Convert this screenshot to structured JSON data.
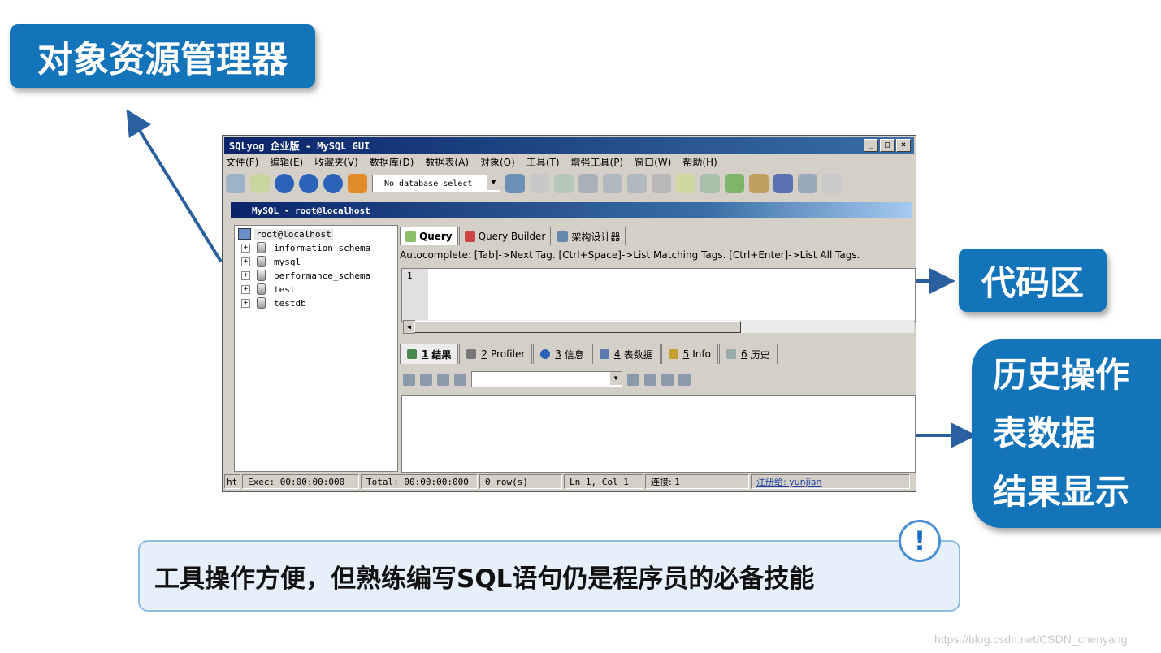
{
  "callouts": {
    "explorer": "对象资源管理器",
    "code": "代码区",
    "history_lines": [
      "历史操作",
      "表数据",
      "结果显示"
    ]
  },
  "tip": {
    "text": "工具操作方便，但熟练编写SQL语句仍是程序员的必备技能",
    "icon": "!"
  },
  "watermark": "https://blog.csdn.net/CSDN_chenyang",
  "window": {
    "title": "SQLyog 企业版 - MySQL GUI",
    "controls": [
      "_",
      "□",
      "×"
    ],
    "menu": [
      "文件(F)",
      "编辑(E)",
      "收藏夹(V)",
      "数据库(D)",
      "数据表(A)",
      "对象(O)",
      "工具(T)",
      "增强工具(P)",
      "窗口(W)",
      "帮助(H)"
    ],
    "db_select": "No database select",
    "connection": "MySQL - root@localhost"
  },
  "explorer": {
    "host": "root@localhost",
    "databases": [
      "information_schema",
      "mysql",
      "performance_schema",
      "test",
      "testdb"
    ]
  },
  "query": {
    "tabs": [
      "Query",
      "Query Builder",
      "架构设计器"
    ],
    "autocomplete": "Autocomplete: [Tab]->Next Tag. [Ctrl+Space]->List Matching Tags. [Ctrl+Enter]->List All Tags.",
    "line_number": "1"
  },
  "results": {
    "tabs": [
      {
        "num": "1",
        "label": "结果"
      },
      {
        "num": "2",
        "label": "Profiler"
      },
      {
        "num": "3",
        "label": "信息"
      },
      {
        "num": "4",
        "label": "表数据"
      },
      {
        "num": "5",
        "label": "Info"
      },
      {
        "num": "6",
        "label": "历史"
      }
    ]
  },
  "status": {
    "ht": "ht",
    "exec": "Exec: 00:00:00:000",
    "total": "Total: 00:00:00:000",
    "rows": "0 row(s)",
    "position": "Ln 1, Col 1",
    "connections": "连接: 1",
    "registered": "注册给: yunjian"
  },
  "colors": {
    "callout_blue": "#1474b9",
    "arrow_blue": "#2a5fa0",
    "tip_bg": "#e6f0fb",
    "title_bar": "#0a246a"
  }
}
